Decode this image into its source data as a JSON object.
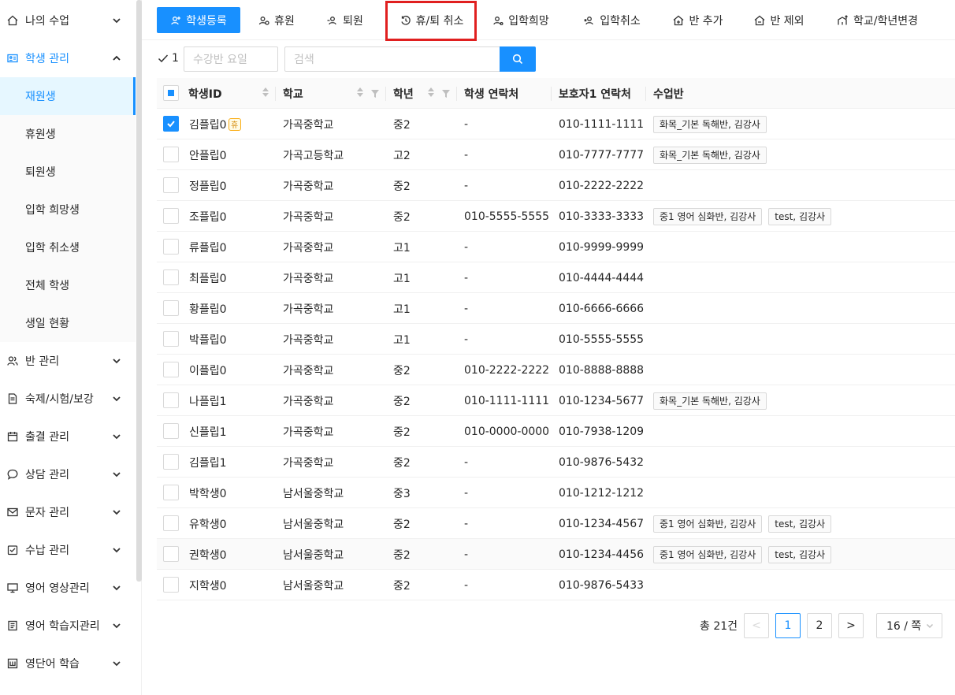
{
  "sidebar": {
    "menus": [
      {
        "key": "my-class",
        "label": "나의 수업",
        "icon": "home-icon"
      },
      {
        "key": "student-mgmt",
        "label": "학생 관리",
        "icon": "id-card-icon",
        "open": true
      },
      {
        "key": "class-mgmt",
        "label": "반 관리",
        "icon": "users-icon"
      },
      {
        "key": "homework",
        "label": "숙제/시험/보강",
        "icon": "document-icon"
      },
      {
        "key": "attendance",
        "label": "출결 관리",
        "icon": "calendar-icon"
      },
      {
        "key": "counsel",
        "label": "상담 관리",
        "icon": "chat-icon"
      },
      {
        "key": "sms",
        "label": "문자 관리",
        "icon": "mail-icon"
      },
      {
        "key": "payment",
        "label": "수납 관리",
        "icon": "payment-icon"
      },
      {
        "key": "video",
        "label": "영어 영상관리",
        "icon": "monitor-icon"
      },
      {
        "key": "worksheet",
        "label": "영어 학습지관리",
        "icon": "book-icon"
      },
      {
        "key": "vocab",
        "label": "영단어 학습",
        "icon": "word-icon"
      }
    ],
    "submenu": [
      "재원생",
      "휴원생",
      "퇴원생",
      "입학 희망생",
      "입학 취소생",
      "전체 학생",
      "생일 현황"
    ],
    "active_submenu": "재원생"
  },
  "toolbar": {
    "buttons": [
      {
        "label": "학생등록",
        "icon": "user-add-icon",
        "primary": true
      },
      {
        "label": "휴원",
        "icon": "user-pause-icon"
      },
      {
        "label": "퇴원",
        "icon": "user-remove-icon"
      },
      {
        "label": "휴/퇴 취소",
        "icon": "undo-clock-icon",
        "highlighted": true
      },
      {
        "label": "입학희망",
        "icon": "user-hope-icon"
      },
      {
        "label": "입학취소",
        "icon": "user-cancel-icon"
      },
      {
        "label": "반 추가",
        "icon": "class-add-icon"
      },
      {
        "label": "반 제외",
        "icon": "class-remove-icon"
      },
      {
        "label": "학교/학년변경",
        "icon": "school-change-icon"
      }
    ]
  },
  "filter": {
    "selected_count": "1",
    "weekday_placeholder": "수강반 요일",
    "search_placeholder": "검색"
  },
  "table": {
    "headers": [
      "학생ID",
      "학교",
      "학년",
      "학생 연락처",
      "보호자1 연락처",
      "수업반"
    ],
    "rows": [
      {
        "name": "김플립0",
        "badge": "휴",
        "checked": true,
        "school": "가곡중학교",
        "grade": "중2",
        "phone": "-",
        "parent": "010-1111-1111",
        "classes": [
          "화목_기본 독해반, 김강사"
        ]
      },
      {
        "name": "안플립0",
        "school": "가곡고등학교",
        "grade": "고2",
        "phone": "-",
        "parent": "010-7777-7777",
        "classes": [
          "화목_기본 독해반, 김강사"
        ]
      },
      {
        "name": "정플립0",
        "school": "가곡중학교",
        "grade": "중2",
        "phone": "-",
        "parent": "010-2222-2222",
        "classes": []
      },
      {
        "name": "조플립0",
        "school": "가곡중학교",
        "grade": "중2",
        "phone": "010-5555-5555",
        "parent": "010-3333-3333",
        "classes": [
          "중1 영어 심화반, 김강사",
          "test, 김강사"
        ]
      },
      {
        "name": "류플립0",
        "school": "가곡중학교",
        "grade": "고1",
        "phone": "-",
        "parent": "010-9999-9999",
        "classes": []
      },
      {
        "name": "최플립0",
        "school": "가곡중학교",
        "grade": "고1",
        "phone": "-",
        "parent": "010-4444-4444",
        "classes": []
      },
      {
        "name": "황플립0",
        "school": "가곡중학교",
        "grade": "고1",
        "phone": "-",
        "parent": "010-6666-6666",
        "classes": []
      },
      {
        "name": "박플립0",
        "school": "가곡중학교",
        "grade": "고1",
        "phone": "-",
        "parent": "010-5555-5555",
        "classes": []
      },
      {
        "name": "이플립0",
        "school": "가곡중학교",
        "grade": "중2",
        "phone": "010-2222-2222",
        "parent": "010-8888-8888",
        "classes": []
      },
      {
        "name": "나플립1",
        "school": "가곡중학교",
        "grade": "중2",
        "phone": "010-1111-1111",
        "parent": "010-1234-5677",
        "classes": [
          "화목_기본 독해반, 김강사"
        ]
      },
      {
        "name": "신플립1",
        "school": "가곡중학교",
        "grade": "중2",
        "phone": "010-0000-0000",
        "parent": "010-7938-1209",
        "classes": []
      },
      {
        "name": "김플립1",
        "school": "가곡중학교",
        "grade": "중2",
        "phone": "-",
        "parent": "010-9876-5432",
        "classes": []
      },
      {
        "name": "박학생0",
        "school": "남서울중학교",
        "grade": "중3",
        "phone": "-",
        "parent": "010-1212-1212",
        "classes": []
      },
      {
        "name": "유학생0",
        "school": "남서울중학교",
        "grade": "중2",
        "phone": "-",
        "parent": "010-1234-4567",
        "classes": [
          "중1 영어 심화반, 김강사",
          "test, 김강사"
        ]
      },
      {
        "name": "권학생0",
        "school": "남서울중학교",
        "grade": "중2",
        "phone": "-",
        "parent": "010-1234-4456",
        "classes": [
          "중1 영어 심화반, 김강사",
          "test, 김강사"
        ],
        "hover": true
      },
      {
        "name": "지학생0",
        "school": "남서울중학교",
        "grade": "중2",
        "phone": "-",
        "parent": "010-9876-5433",
        "classes": []
      }
    ]
  },
  "pagination": {
    "total": "총 21건",
    "prev": "<",
    "pages": [
      "1",
      "2"
    ],
    "current": "1",
    "next": ">",
    "page_size": "16 / 쪽"
  },
  "colors": {
    "accent": "#1890ff",
    "highlight": "#e01f1f",
    "badge": "#faad14"
  }
}
